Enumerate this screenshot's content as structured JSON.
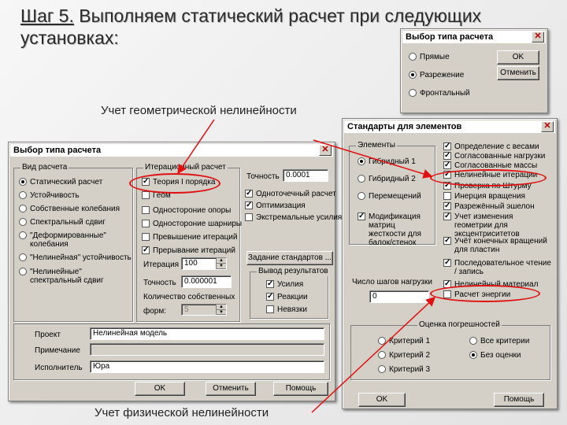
{
  "slide": {
    "title_step": "Шаг 5.",
    "title_rest": " Выполняем статический расчет при следующих установках:",
    "annotation_geom": "Учет геометрической нелинейности",
    "annotation_phys": "Учет физической нелинейности"
  },
  "small_dialog": {
    "title": "Выбор типа расчета",
    "options": [
      "Прямые",
      "Разрежение",
      "Фронтальный"
    ],
    "selected": 1,
    "ok": "OK",
    "cancel": "Отменить"
  },
  "main_dialog": {
    "title": "Выбор типа расчета",
    "calc_type": {
      "caption": "Вид расчета",
      "options": [
        "Статический расчет",
        "Устойчивость",
        "Собственные колебания",
        "Спектральный сдвиг",
        "\"Деформированные\" колебания",
        "\"Нелинейная\" устойчивость",
        "\"Нелинейные\" спектральный сдвиг"
      ],
      "selected": 0
    },
    "iterative": {
      "caption": "Итерационный расчет",
      "items": [
        "Теория I порядка",
        "Геом",
        "Одностороние опоры",
        "Одностороние шарниры",
        "Превышение итераций",
        "Прерывание итераций"
      ],
      "checked": [
        true,
        false,
        false,
        false,
        false,
        true
      ],
      "iterations_label": "Итерация",
      "iterations_value": "100",
      "accuracy_label": "Точность",
      "accuracy_value": "0.000001",
      "eigen_label": "Количество собственных",
      "forms_label": "форм:",
      "forms_value": "5"
    },
    "accuracy": {
      "label": "Точность",
      "value": "0.0001"
    },
    "options": {
      "items": [
        "Одноточечный расчет",
        "Оптимизация",
        "Экстремальные усилия"
      ],
      "checked": [
        true,
        true,
        false
      ]
    },
    "standards_button": "Задание стандартов ...",
    "output": {
      "caption": "Вывод результатов",
      "items": [
        "Усилия",
        "Реакции",
        "Невязки"
      ],
      "checked": [
        true,
        true,
        false
      ]
    },
    "project": {
      "label": "Проект",
      "value": "Нелинейная модель"
    },
    "note": {
      "label": "Примечание",
      "value": ""
    },
    "executor": {
      "label": "Исполнитель",
      "value": "Юра"
    },
    "ok": "OK",
    "cancel": "Отменить",
    "help": "Помощь"
  },
  "standards_dialog": {
    "title": "Стандарты для элементов",
    "elements": {
      "caption": "Элементы",
      "options": [
        "Гибридный 1",
        "Гибридный 2",
        "Перемещений"
      ],
      "selected": 0,
      "modification_label": "Модификация матриц жесткости для балок/стенок",
      "modification_checked": true
    },
    "items": [
      {
        "label": "Определение с весами",
        "checked": true
      },
      {
        "label": "Согласованные нагрузки",
        "checked": true
      },
      {
        "label": "Согласованные массы",
        "checked": true
      },
      {
        "label": "Нелинейные итерации",
        "checked": true
      },
      {
        "label": "Проверка по Штурму",
        "checked": true
      },
      {
        "label": "Инерция вращения",
        "checked": false
      },
      {
        "label": "Разрежённый эшелон",
        "checked": true
      },
      {
        "label": "Учет изменения геометрии для эксцентриситетов",
        "checked": true
      },
      {
        "label": "Учёт конечных вращений для пластин",
        "checked": true
      },
      {
        "label": "Последовательное чтение / запись",
        "checked": true
      },
      {
        "label": "Нелинейный материал",
        "checked": true
      },
      {
        "label": "Расчет энергии",
        "checked": false
      }
    ],
    "load_steps_label": "Число шагов нагрузки",
    "load_steps_value": "0",
    "error_estimate": {
      "caption": "Оценка погрешностей",
      "options": [
        "Критерий 1",
        "Все критерии",
        "Критерий 2",
        "Без оценки",
        "Критерий 3"
      ],
      "selected": 3
    },
    "ok": "OK",
    "help": "Помощь"
  },
  "colors": {
    "annotation_red": "#e01010",
    "dialog_gray": "#d4d0c8"
  }
}
